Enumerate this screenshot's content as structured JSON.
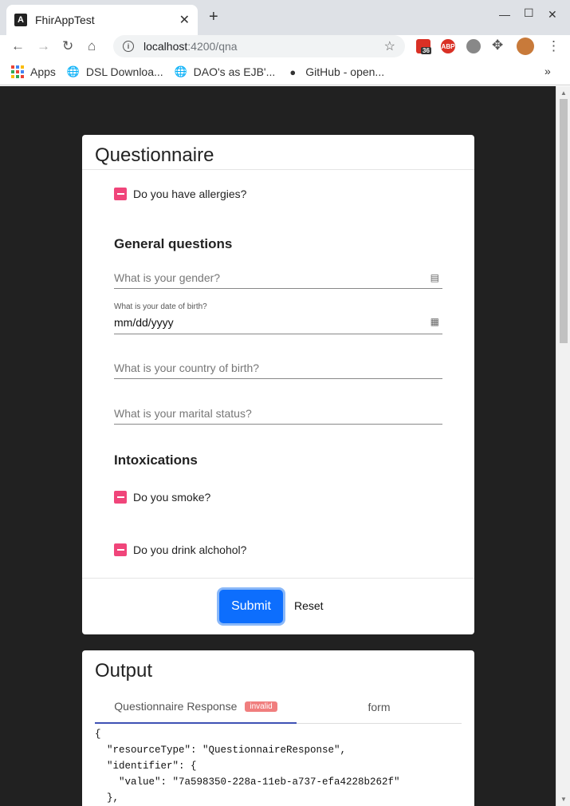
{
  "browser": {
    "tab_title": "FhirAppTest",
    "tab_close": "✕",
    "new_tab": "+",
    "url_host": "localhost",
    "url_path": ":4200/qna",
    "ext_badge": "36",
    "ext_abp": "ABP",
    "bookmarks": [
      "Apps",
      "DSL Downloa...",
      "DAO's as EJB'...",
      "GitHub - open..."
    ],
    "more": "»"
  },
  "questionnaire": {
    "title": "Questionnaire",
    "allergies": "Do you have allergies?",
    "general_heading": "General questions",
    "gender_placeholder": "What is your gender?",
    "dob_label": "What is your date of birth?",
    "dob_value": "mm/dd/yyyy",
    "country_placeholder": "What is your country of birth?",
    "marital_placeholder": "What is your marital status?",
    "intox_heading": "Intoxications",
    "smoke": "Do you smoke?",
    "alcohol": "Do you drink alchohol?",
    "submit": "Submit",
    "reset": "Reset"
  },
  "output": {
    "title": "Output",
    "tab_response": "Questionnaire Response",
    "badge": "invalid",
    "tab_form": "form",
    "code": "{\n  \"resourceType\": \"QuestionnaireResponse\",\n  \"identifier\": {\n    \"value\": \"7a598350-228a-11eb-a737-efa4228b262f\"\n  },"
  },
  "colors": {
    "checkbox": "#f0457a",
    "submit": "#0d6efd",
    "badge": "#f07e7e",
    "tab_indicator": "#3f51b5",
    "page_bg": "#212121"
  }
}
